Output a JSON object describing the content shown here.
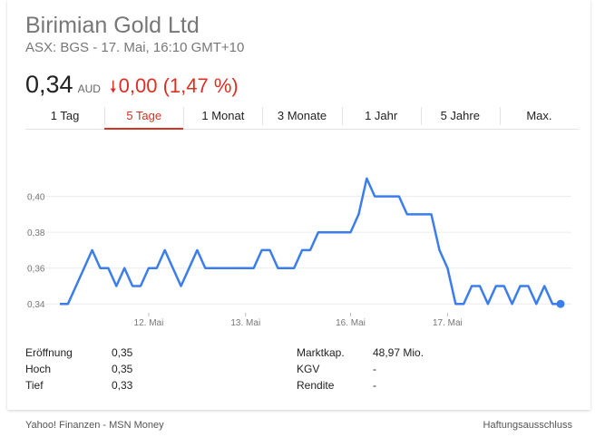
{
  "header": {
    "title": "Birimian Gold Ltd",
    "subtitle": "ASX: BGS - 17. Mai, 16:10 GMT+10",
    "price": "0,34",
    "currency": "AUD",
    "change_arrow": "🠗",
    "change": "0,00 (1,47 %)"
  },
  "colors": {
    "line": "#3b7ded",
    "negative": "#d93025",
    "grid": "#ececec"
  },
  "tabs": [
    {
      "label": "1 Tag",
      "active": false
    },
    {
      "label": "5 Tage",
      "active": true
    },
    {
      "label": "1 Monat",
      "active": false
    },
    {
      "label": "3 Monate",
      "active": false
    },
    {
      "label": "1 Jahr",
      "active": false
    },
    {
      "label": "5 Jahre",
      "active": false
    },
    {
      "label": "Max.",
      "active": false
    }
  ],
  "chart_data": {
    "type": "line",
    "ylim": [
      0.33,
      0.415
    ],
    "y_ticks": [
      {
        "value": 0.34,
        "label": "0,34"
      },
      {
        "value": 0.36,
        "label": "0,36"
      },
      {
        "value": 0.38,
        "label": "0,38"
      },
      {
        "value": 0.4,
        "label": "0,40"
      }
    ],
    "x_ticks": [
      {
        "index": 11,
        "label": "12. Mai"
      },
      {
        "index": 23,
        "label": "13. Mai"
      },
      {
        "index": 36,
        "label": "16. Mai"
      },
      {
        "index": 48,
        "label": "17. Mai"
      }
    ],
    "grid": true,
    "series": [
      {
        "values": [
          0.34,
          0.34,
          0.35,
          0.36,
          0.37,
          0.36,
          0.36,
          0.35,
          0.36,
          0.35,
          0.35,
          0.36,
          0.36,
          0.37,
          0.36,
          0.35,
          0.36,
          0.37,
          0.36,
          0.36,
          0.36,
          0.36,
          0.36,
          0.36,
          0.36,
          0.37,
          0.37,
          0.36,
          0.36,
          0.36,
          0.37,
          0.37,
          0.38,
          0.38,
          0.38,
          0.38,
          0.38,
          0.39,
          0.41,
          0.4,
          0.4,
          0.4,
          0.4,
          0.39,
          0.39,
          0.39,
          0.39,
          0.37,
          0.36,
          0.34,
          0.34,
          0.35,
          0.35,
          0.34,
          0.35,
          0.35,
          0.34,
          0.35,
          0.35,
          0.34,
          0.35,
          0.34,
          0.34
        ]
      }
    ]
  },
  "stats_left": [
    {
      "label": "Eröffnung",
      "value": "0,35"
    },
    {
      "label": "Hoch",
      "value": "0,35"
    },
    {
      "label": "Tief",
      "value": "0,33"
    }
  ],
  "stats_right": [
    {
      "label": "Marktkap.",
      "value": "48,97 Mio."
    },
    {
      "label": "KGV",
      "value": "-"
    },
    {
      "label": "Rendite",
      "value": "-"
    }
  ],
  "footer": {
    "source": "Yahoo! Finanzen - MSN Money",
    "disclaimer": "Haftungsausschluss"
  }
}
